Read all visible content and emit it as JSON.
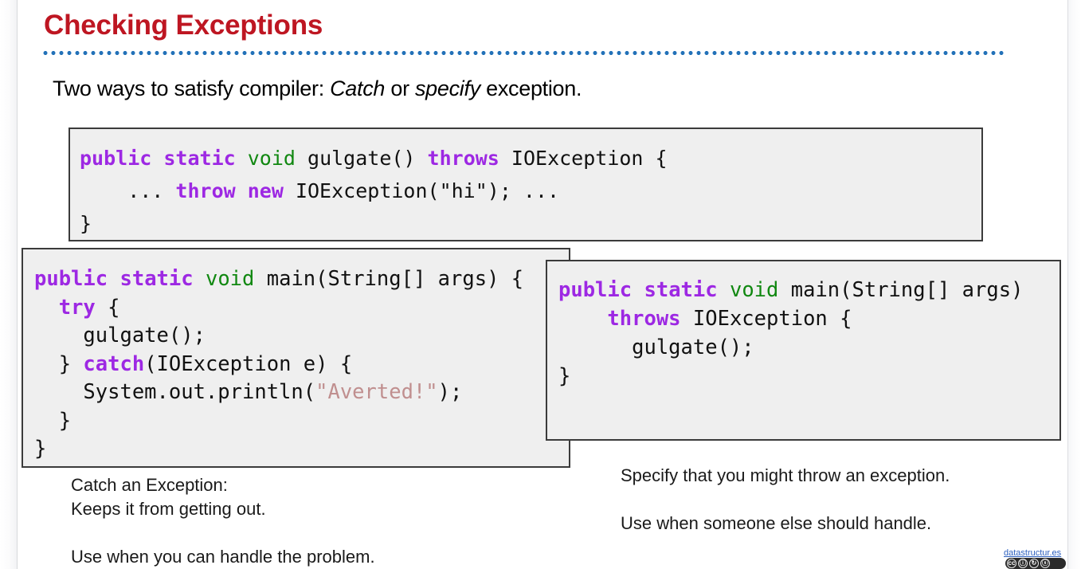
{
  "slide": {
    "title": "Checking Exceptions",
    "subtitle": {
      "lead": "Two ways to satisfy compiler: ",
      "emphasis_one": "Catch",
      "middle": " or ",
      "emphasis_two": "specify",
      "trail": " exception."
    }
  },
  "code_top": {
    "name": "gulgate-throws-example",
    "lines": [
      {
        "tokens": [
          {
            "t": "public",
            "c": "kw"
          },
          {
            "t": " "
          },
          {
            "t": "static",
            "c": "kw"
          },
          {
            "t": " "
          },
          {
            "t": "void",
            "c": "kwt"
          },
          {
            "t": " gulgate() "
          },
          {
            "t": "throws",
            "c": "kw"
          },
          {
            "t": " IOException {"
          }
        ]
      },
      {
        "tokens": [
          {
            "t": "    ... "
          },
          {
            "t": "throw",
            "c": "kw"
          },
          {
            "t": " "
          },
          {
            "t": "new",
            "c": "kw"
          },
          {
            "t": " IOException(\"hi\"); ..."
          }
        ]
      },
      {
        "tokens": [
          {
            "t": "}"
          }
        ]
      }
    ]
  },
  "code_catch": {
    "name": "try-catch-example",
    "lines": [
      {
        "tokens": [
          {
            "t": "public",
            "c": "kw"
          },
          {
            "t": " "
          },
          {
            "t": "static",
            "c": "kw"
          },
          {
            "t": " "
          },
          {
            "t": "void",
            "c": "kwt"
          },
          {
            "t": " main(String[] args) {"
          }
        ]
      },
      {
        "tokens": [
          {
            "t": "  "
          },
          {
            "t": "try",
            "c": "kw"
          },
          {
            "t": " {"
          }
        ]
      },
      {
        "tokens": [
          {
            "t": "    gulgate();"
          }
        ]
      },
      {
        "tokens": [
          {
            "t": "  } "
          },
          {
            "t": "catch",
            "c": "kw"
          },
          {
            "t": "(IOException e) {"
          }
        ]
      },
      {
        "tokens": [
          {
            "t": "    System.out.println("
          },
          {
            "t": "\"Averted!\"",
            "c": "str"
          },
          {
            "t": ");"
          }
        ]
      },
      {
        "tokens": [
          {
            "t": "  }"
          }
        ]
      },
      {
        "tokens": [
          {
            "t": "}"
          }
        ]
      }
    ]
  },
  "code_specify": {
    "name": "throws-declaration-example",
    "lines": [
      {
        "tokens": [
          {
            "t": "public",
            "c": "kw"
          },
          {
            "t": " "
          },
          {
            "t": "static",
            "c": "kw"
          },
          {
            "t": " "
          },
          {
            "t": "void",
            "c": "kwt"
          },
          {
            "t": " main(String[] args)"
          }
        ]
      },
      {
        "tokens": [
          {
            "t": "    "
          },
          {
            "t": "throws",
            "c": "kw"
          },
          {
            "t": " IOException {"
          }
        ]
      },
      {
        "tokens": [
          {
            "t": "      gulgate();"
          }
        ]
      },
      {
        "tokens": [
          {
            "t": "}"
          }
        ]
      }
    ]
  },
  "caption_catch": "Catch an Exception:\nKeeps it from getting out.\n\nUse when you can handle the problem.",
  "caption_specify": "Specify that you might throw an exception.\n\nUse when someone else should handle.",
  "footer": {
    "link_text": "datastructur.es",
    "license_marks": [
      "cc",
      "by",
      "sa",
      "nc"
    ]
  },
  "colors": {
    "title": "#BE1622",
    "underline_dots": "#2372B8",
    "keyword": "#9D28E3",
    "type": "#118811",
    "string": "#C08F8F",
    "code_bg": "#EFEFEF",
    "code_border": "#3B3B3B"
  }
}
